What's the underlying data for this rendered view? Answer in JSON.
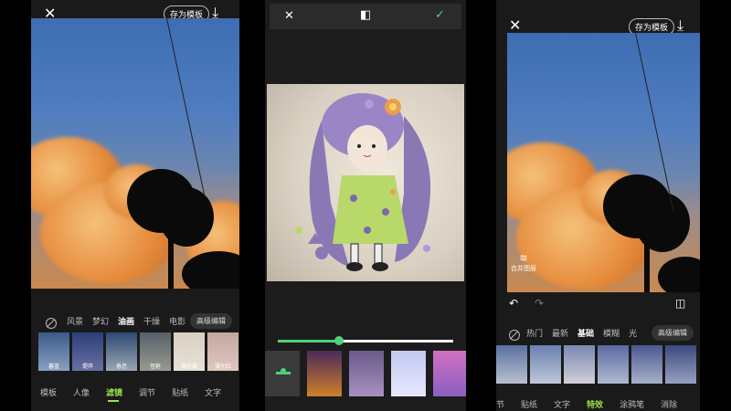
{
  "left": {
    "save_template": "存为模板",
    "filter_tabs": [
      "风景",
      "梦幻",
      "油画",
      "干燥",
      "电影"
    ],
    "active_filter_tab": "油画",
    "advanced_edit": "高级编辑",
    "thumbs": [
      {
        "label": "暮蓝",
        "colors": [
          "#3a5a8a",
          "#8aa0c0"
        ]
      },
      {
        "label": "堤岸",
        "colors": [
          "#2a3f7a",
          "#6a70a0"
        ]
      },
      {
        "label": "倦怠",
        "colors": [
          "#2d4a70",
          "#9aa6b5"
        ]
      },
      {
        "label": "怪射",
        "colors": [
          "#55606a",
          "#9a9a90"
        ]
      },
      {
        "label": "薄光晨",
        "colors": [
          "#d8d0c0",
          "#e8e0d8"
        ]
      },
      {
        "label": "薄光红",
        "colors": [
          "#c0a8a0",
          "#e0c8c0"
        ]
      }
    ],
    "nav": [
      "模板",
      "人像",
      "滤镜",
      "调节",
      "贴纸",
      "文字"
    ],
    "active_nav": "滤镜"
  },
  "middle": {
    "slider_value": 0.35,
    "accent": "#4cd37a"
  },
  "right": {
    "save_template": "存为模板",
    "merge_layers": "合并图层",
    "effect_tabs": [
      "热门",
      "最新",
      "基础",
      "模糊",
      "光"
    ],
    "active_effect_tab": "基础",
    "advanced_edit": "高级编辑",
    "nav": [
      "节",
      "贴纸",
      "文字",
      "特效",
      "涂鸦笔",
      "消除"
    ],
    "active_nav": "特效"
  }
}
